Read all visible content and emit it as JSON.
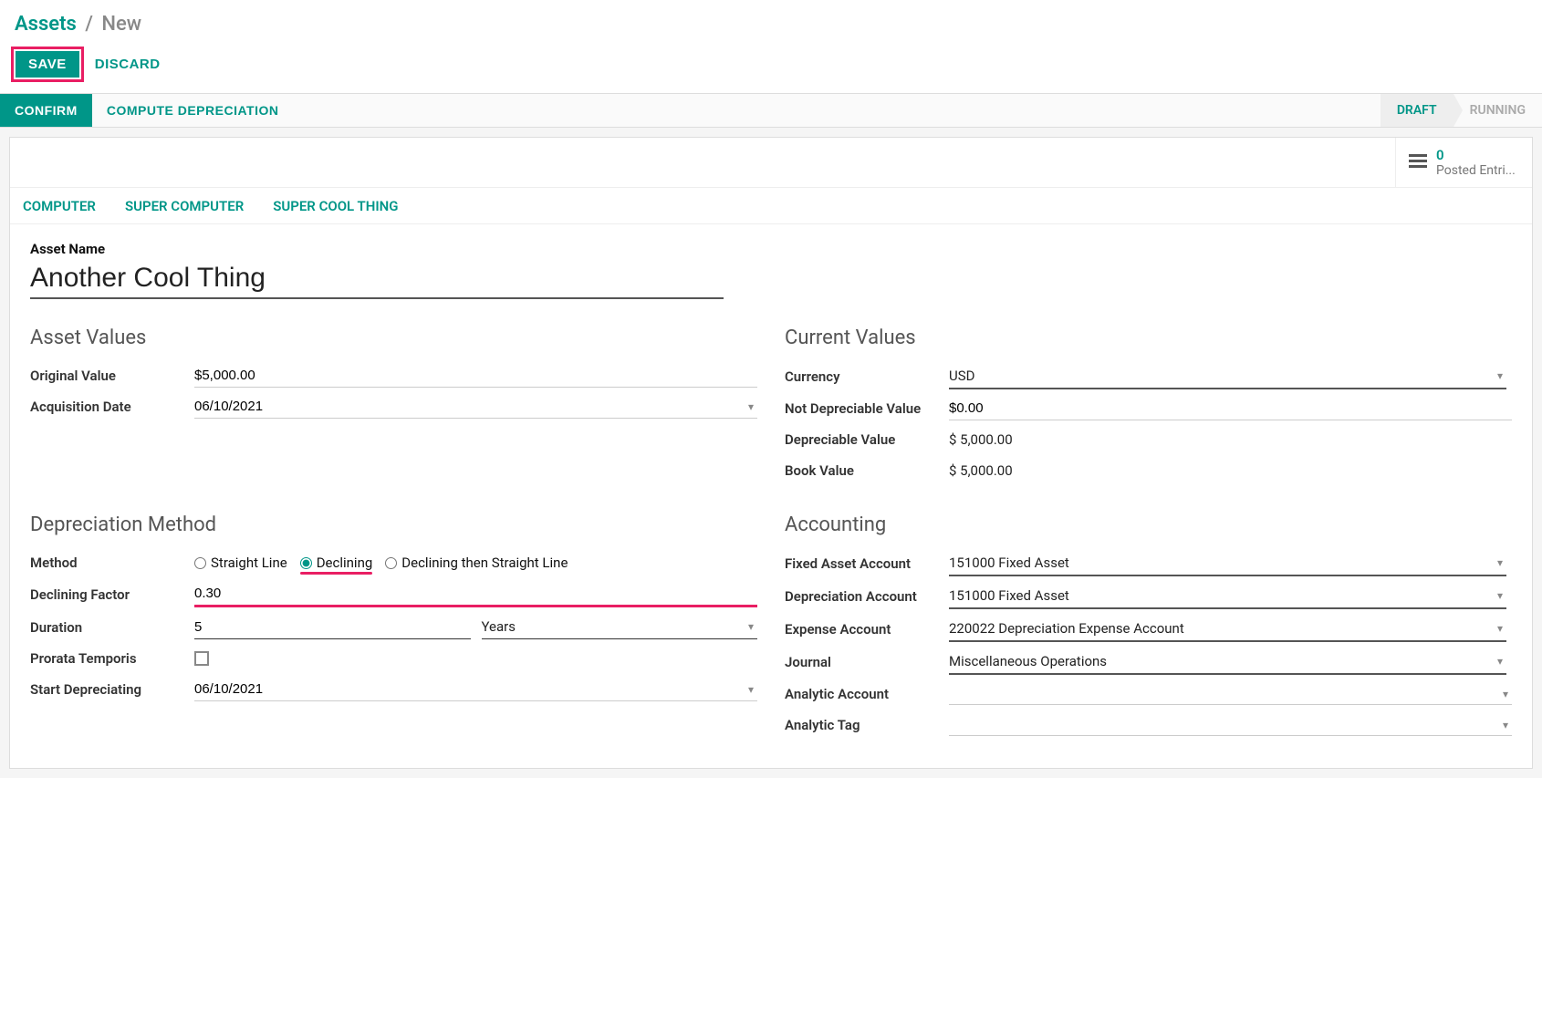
{
  "breadcrumb": {
    "root": "Assets",
    "sep": "/",
    "leaf": "New"
  },
  "actions": {
    "save": "SAVE",
    "discard": "DISCARD"
  },
  "statusbar": {
    "confirm": "CONFIRM",
    "compute": "COMPUTE DEPRECIATION",
    "stages": {
      "draft": "DRAFT",
      "running": "RUNNING"
    }
  },
  "button_box": {
    "posted_entries": {
      "count": "0",
      "label": "Posted Entri..."
    }
  },
  "related_tabs": [
    "COMPUTER",
    "SUPER COMPUTER",
    "SUPER COOL THING"
  ],
  "asset_name": {
    "label": "Asset Name",
    "value": "Another Cool Thing"
  },
  "asset_values": {
    "title": "Asset Values",
    "original_value": {
      "label": "Original Value",
      "value": "$5,000.00"
    },
    "acquisition_date": {
      "label": "Acquisition Date",
      "value": "06/10/2021"
    }
  },
  "current_values": {
    "title": "Current Values",
    "currency": {
      "label": "Currency",
      "value": "USD"
    },
    "not_depreciable": {
      "label": "Not Depreciable Value",
      "value": "$0.00"
    },
    "depreciable": {
      "label": "Depreciable Value",
      "value": "$ 5,000.00"
    },
    "book_value": {
      "label": "Book Value",
      "value": "$ 5,000.00"
    }
  },
  "depreciation_method": {
    "title": "Depreciation Method",
    "method": {
      "label": "Method",
      "options": {
        "straight": "Straight Line",
        "declining": "Declining",
        "declining_straight": "Declining then Straight Line"
      },
      "selected": "declining"
    },
    "declining_factor": {
      "label": "Declining Factor",
      "value": "0.30"
    },
    "duration": {
      "label": "Duration",
      "value": "5",
      "unit": "Years"
    },
    "prorata": {
      "label": "Prorata Temporis"
    },
    "start": {
      "label": "Start Depreciating",
      "value": "06/10/2021"
    }
  },
  "accounting": {
    "title": "Accounting",
    "fixed_asset_account": {
      "label": "Fixed Asset Account",
      "value": "151000 Fixed Asset"
    },
    "depreciation_account": {
      "label": "Depreciation Account",
      "value": "151000 Fixed Asset"
    },
    "expense_account": {
      "label": "Expense Account",
      "value": "220022 Depreciation Expense Account"
    },
    "journal": {
      "label": "Journal",
      "value": "Miscellaneous Operations"
    },
    "analytic_account": {
      "label": "Analytic Account",
      "value": ""
    },
    "analytic_tag": {
      "label": "Analytic Tag",
      "value": ""
    }
  }
}
